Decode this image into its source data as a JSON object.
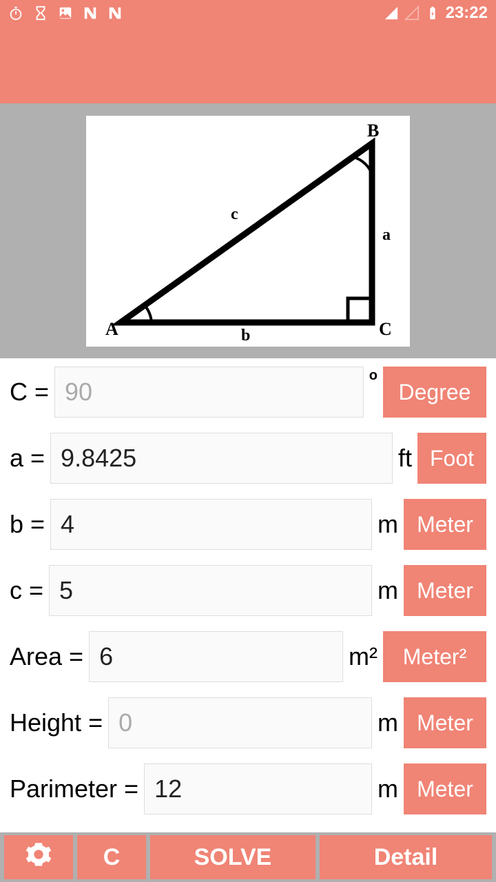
{
  "status": {
    "time": "23:22"
  },
  "diagram": {
    "vertex_labels": {
      "A": "A",
      "B": "B",
      "C": "C"
    },
    "side_labels": {
      "a": "a",
      "b": "b",
      "c": "c"
    }
  },
  "rows": {
    "angleC": {
      "label": "C = ",
      "value": "90",
      "suffix": "°",
      "unit_button": "Degree",
      "placeholder": true
    },
    "a": {
      "label": "a = ",
      "value": "9.8425",
      "suffix": "ft",
      "unit_button": "Foot"
    },
    "b": {
      "label": "b = ",
      "value": "4",
      "suffix": "m",
      "unit_button": "Meter"
    },
    "c": {
      "label": "c = ",
      "value": "5",
      "suffix": "m",
      "unit_button": "Meter"
    },
    "area": {
      "label": "Area = ",
      "value": "6",
      "suffix": "m²",
      "unit_button": "Meter²"
    },
    "height": {
      "label": "Height = ",
      "value": "0",
      "suffix": "m",
      "unit_button": "Meter",
      "placeholder": true
    },
    "perim": {
      "label": "Parimeter = ",
      "value": "12",
      "suffix": "m",
      "unit_button": "Meter"
    }
  },
  "bottom": {
    "clear": "C",
    "solve": "SOLVE",
    "detail": "Detail"
  }
}
